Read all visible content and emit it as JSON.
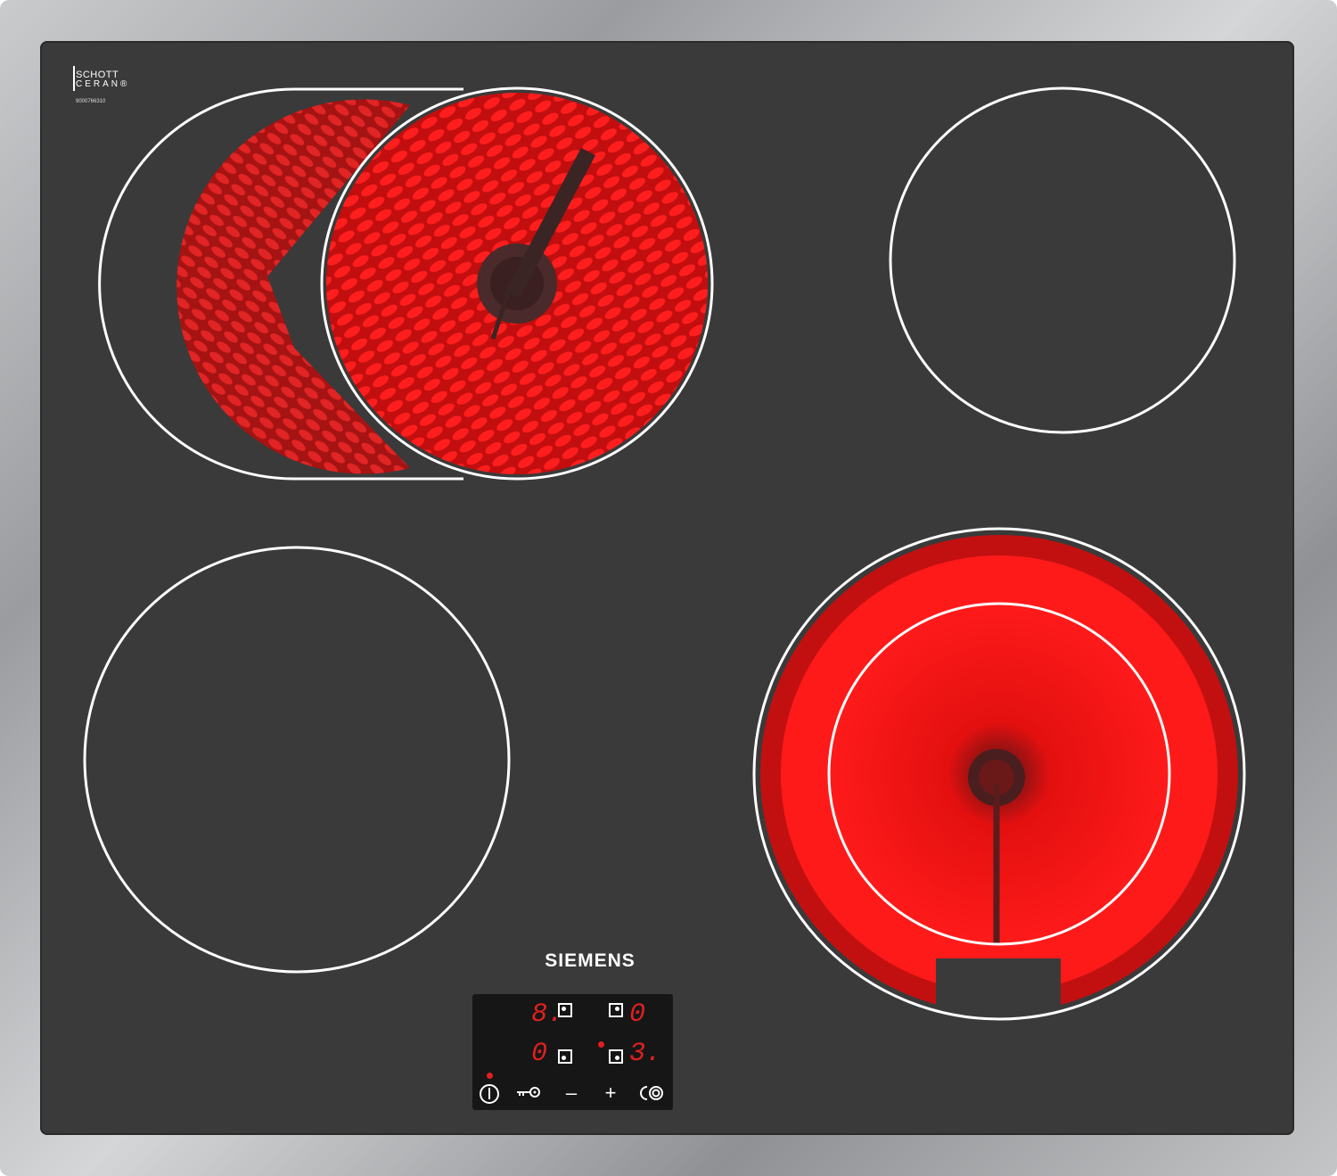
{
  "image": {
    "logo": {
      "line1": "SCHOTT",
      "line2": "CERAN®"
    },
    "serial": "9000766310",
    "brand": "SIEMENS",
    "colors": {
      "glass": "#3a3a3a",
      "heat": "#e31010",
      "ring": "#ffffff",
      "display": "#e02020"
    },
    "display": {
      "zone_front_left": "8.",
      "zone_back_right": "0",
      "zone_front_left_bottom": "0",
      "zone_front_right": "3."
    },
    "controls": {
      "power": "power-icon",
      "childlock": "key-icon",
      "minus": "–",
      "plus": "+",
      "zone": "dual-zone-icon"
    }
  }
}
